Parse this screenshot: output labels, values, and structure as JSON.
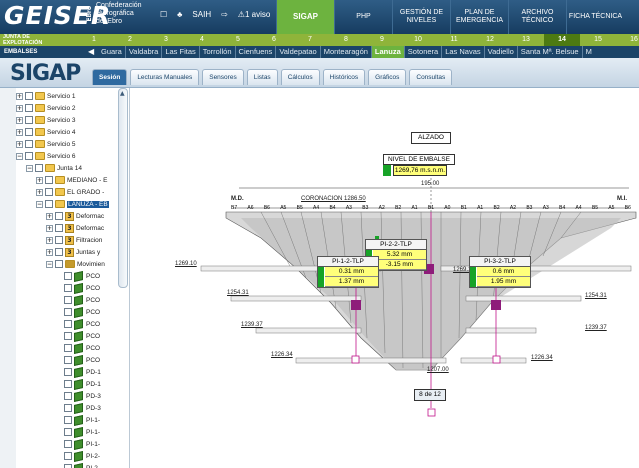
{
  "header": {
    "logo": "GEISER",
    "ebro": "Ebro",
    "org_lines": [
      "Confederación",
      "Hidrográfica",
      "del Ebro"
    ],
    "tools": [
      "☐",
      "♣",
      "SAIH",
      "⇨",
      "⚠1 aviso"
    ],
    "nav": [
      {
        "label": "SIGAP",
        "active": true
      },
      {
        "label": "PHP",
        "active": false
      },
      {
        "label": "GESTIÓN DE NIVELES",
        "active": false
      },
      {
        "label": "PLAN DE EMERGENCIA",
        "active": false
      },
      {
        "label": "ARCHIVO TÉCNICO",
        "active": false
      },
      {
        "label": "FICHA TÉCNICA",
        "active": false
      }
    ]
  },
  "junta": {
    "label_lines": [
      "JUNTA DE",
      "EXPLOTACIÓN"
    ],
    "numbers": [
      "1",
      "2",
      "3",
      "4",
      "5",
      "6",
      "7",
      "8",
      "9",
      "10",
      "11",
      "12",
      "13",
      "14",
      "15",
      "16"
    ],
    "selected": "14"
  },
  "embalses": {
    "label": "EMBALSES",
    "items": [
      "Guara",
      "Valdabra",
      "Las Fitas",
      "Torrollón",
      "Cienfuens",
      "Valdepatao",
      "Montearagón",
      "Lanuza",
      "Sotonera",
      "Las Navas",
      "Vadiello",
      "Santa Mª. Belsue",
      "M"
    ],
    "selected": "Lanuza"
  },
  "tabbar": {
    "logo": "SIGAP",
    "tabs": [
      {
        "label": "Sesión",
        "active": true
      },
      {
        "label": "Lecturas Manuales",
        "active": false
      },
      {
        "label": "Sensores",
        "active": false
      },
      {
        "label": "Listas",
        "active": false
      },
      {
        "label": "Cálculos",
        "active": false
      },
      {
        "label": "Históricos",
        "active": false
      },
      {
        "label": "Gráficos",
        "active": false
      },
      {
        "label": "Consultas",
        "active": false
      }
    ]
  },
  "tree": {
    "servicios": [
      "Servicio 1",
      "Servicio 2",
      "Servicio 3",
      "Servicio 4",
      "Servicio 5",
      "Servicio 6"
    ],
    "junta": "Junta 14",
    "embalses": [
      "MEDIANO - E",
      "EL GRADO -",
      "LANUZA - EB"
    ],
    "sub": [
      "Deformac",
      "Deformac",
      "Filtracion",
      "Juntas y",
      "Movimien"
    ],
    "leaves": [
      "PCO",
      "PCO",
      "PCO",
      "PCO",
      "PCO",
      "PCO",
      "PCO",
      "PCO",
      "PD-1",
      "PD-1",
      "PD-3",
      "PD-3",
      "PI-1-",
      "PI-1-",
      "PI-1-",
      "PI-2-",
      "PI-2-"
    ]
  },
  "drawing": {
    "title": "ALZADO",
    "nivel_label": "NIVEL DE EMBALSE",
    "nivel_value": "1269,76 m.s.n.m.",
    "dim": "195.00",
    "md": "M.D.",
    "mi": "M.I.",
    "coronacion": "CORONACION 1286.50",
    "blocks": [
      "B7",
      "A6",
      "B6",
      "A5",
      "B5",
      "A4",
      "B4",
      "A3",
      "B3",
      "A2",
      "B2",
      "A1",
      "B1",
      "A0",
      "B1",
      "A1",
      "B2",
      "A2",
      "B3",
      "A3",
      "B4",
      "A4",
      "B5",
      "A5",
      "B6"
    ],
    "levels_left": [
      "1269.10",
      "1254.31",
      "1239.37",
      "1226.34"
    ],
    "levels_right": [
      "1269.10",
      "1254.31",
      "1239.37",
      "1226.34"
    ],
    "base": "1207.00",
    "page": "8 de 12",
    "sensors": [
      {
        "name": "PI-2-2-TLP",
        "v1": "5.32 mm",
        "v2": "-3.15 mm"
      },
      {
        "name": "PI-1-2-TLP",
        "v1": "0.31 mm",
        "v2": "1.37 mm"
      },
      {
        "name": "PI-3-2-TLP",
        "v1": "0.6 mm",
        "v2": "1.95 mm"
      }
    ]
  }
}
